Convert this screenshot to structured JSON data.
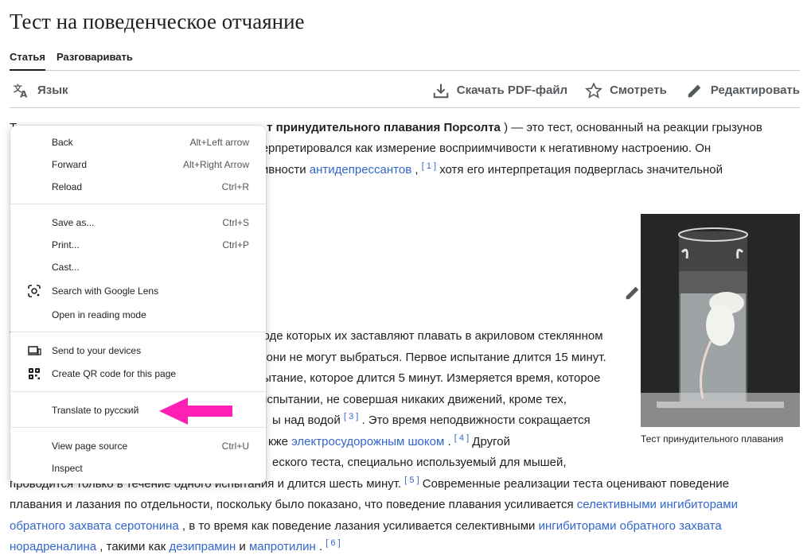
{
  "page": {
    "title": "Тест на поведенческое отчаяние",
    "tabs": [
      {
        "label": "Статья",
        "active": true
      },
      {
        "label": "Разговаривать",
        "active": false
      }
    ],
    "toolbar": {
      "language": "Язык",
      "download_pdf": "Скачать PDF-файл",
      "watch": "Смотреть",
      "edit": "Редактировать"
    }
  },
  "article": {
    "p1_l1_bold": "т принудительного плавания Порсолта",
    "p1_l1_rest": " ) — это тест, основанный на реакции грызунов",
    "p1_l2": "терпретировался как измерение восприимчивости к негативному настроению. Он",
    "p1_l3_pre": "тивности ",
    "p1_l3_link": "антидепрессантов",
    "p1_l3_ref": "[ 1 ]",
    "p1_l3_post": " хотя его интерпретация подверглась значительной",
    "p2_l1": "ходе которых их заставляют плавать в акриловом стеклянном",
    "p2_l2": "о они не могут выбраться. Первое испытание длится 15 минут.",
    "p2_l3": "пытание, которое длится 5 минут. Измеряется время, которое",
    "p2_l4": " испытании, не совершая никаких движений, кроме тех,",
    "p2_l5_pre": "ы над водой ",
    "p2_l5_ref": "[ 3 ]",
    "p2_l5_post": " . Это время неподвижности сокращается",
    "p2_l6_pre": "кже ",
    "p2_l6_link": "электросудорожным шоком",
    "p2_l6_ref": "[ 4 ]",
    "p2_l6_post": " Другой",
    "p2_l7": "еского теста, специально используемый для мышей,",
    "p2_l8_pre": "проводится только в течение одного испытания и длится шесть минут. ",
    "p2_l8_ref": "[ 5 ]",
    "p2_l8_post": " Современные реализации теста оценивают поведение",
    "p2_l9_pre": "плавания и лазания по отдельности, поскольку было показано, что поведение плавания усиливается ",
    "p2_l9_link": "селективными ингибиторами",
    "p2_l10_link": "обратного захвата серотонина",
    "p2_l10_mid": " , в то время как поведение лазания усиливается селективными ",
    "p2_l10_link2": "ингибиторами обратного захвата",
    "p2_l11_link": "норадреналина",
    "p2_l11_mid": " , такими как ",
    "p2_l11_link2": "дезипрамин",
    "p2_l11_and": " и ",
    "p2_l11_link3": "мапротилин",
    "p2_l11_ref": "[ 6 ]"
  },
  "figure": {
    "caption": "Тест принудительного плавания"
  },
  "context_menu": {
    "items": [
      {
        "label": "Back",
        "shortcut": "Alt+Left arrow"
      },
      {
        "label": "Forward",
        "shortcut": "Alt+Right Arrow"
      },
      {
        "label": "Reload",
        "shortcut": "Ctrl+R"
      },
      {
        "label": "Save as...",
        "shortcut": "Ctrl+S"
      },
      {
        "label": "Print...",
        "shortcut": "Ctrl+P"
      },
      {
        "label": "Cast...",
        "shortcut": ""
      },
      {
        "label": "Search with Google Lens",
        "shortcut": "",
        "icon": "google-lens-icon"
      },
      {
        "label": "Open in reading mode",
        "shortcut": ""
      },
      {
        "label": "Send to your devices",
        "shortcut": "",
        "icon": "devices-icon"
      },
      {
        "label": "Create QR code for this page",
        "shortcut": "",
        "icon": "qr-code-icon"
      },
      {
        "label": "Translate to русский",
        "shortcut": ""
      },
      {
        "label": "View page source",
        "shortcut": "Ctrl+U"
      },
      {
        "label": "Inspect",
        "shortcut": ""
      }
    ]
  },
  "colors": {
    "link": "#3366cc",
    "arrow": "#ff1fb4"
  }
}
